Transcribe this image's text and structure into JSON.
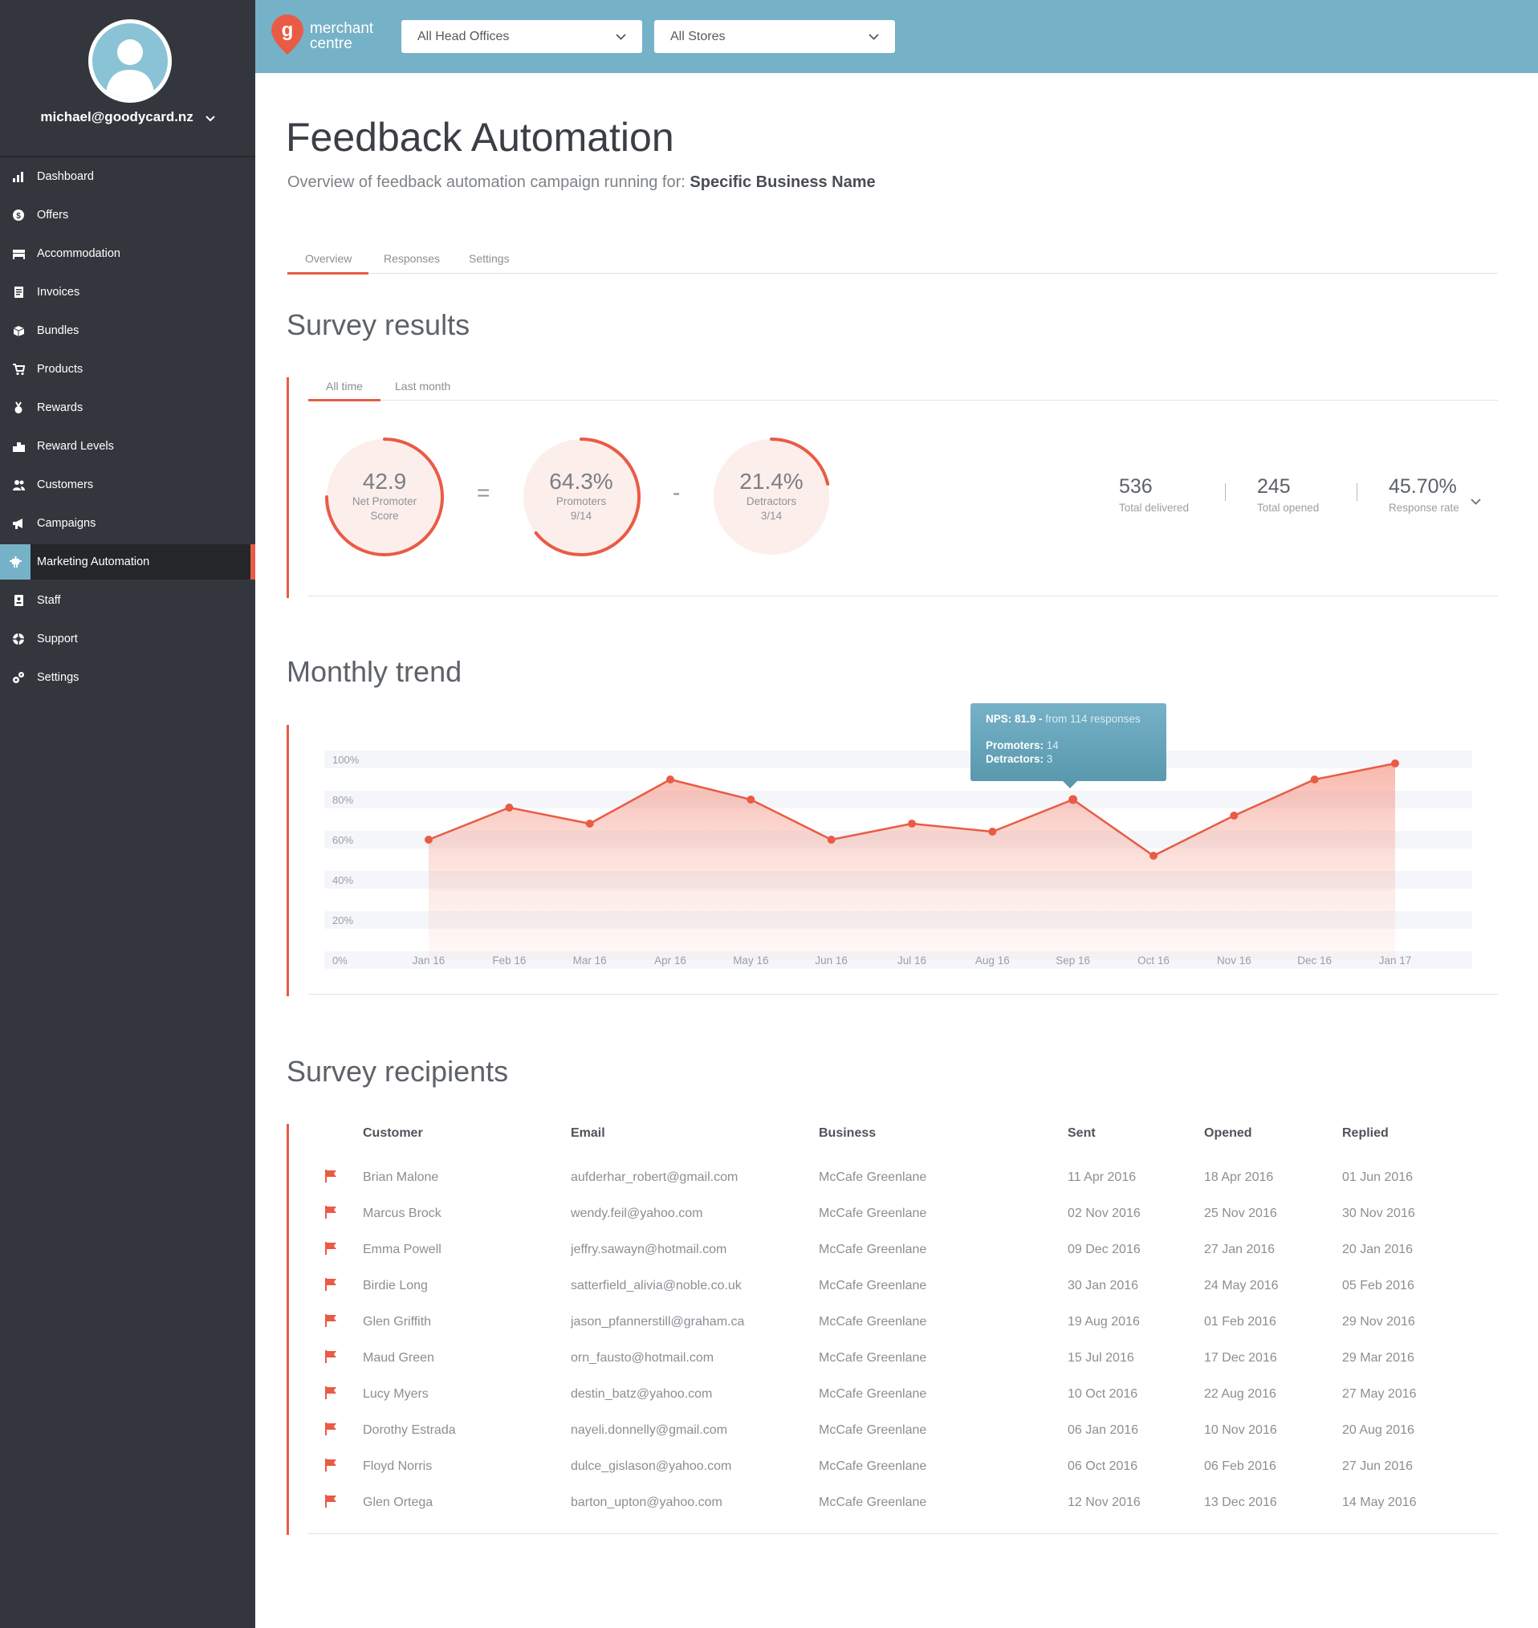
{
  "user": {
    "email": "michael@goodycard.nz"
  },
  "nav": [
    {
      "label": "Dashboard",
      "icon": "bar-chart-icon"
    },
    {
      "label": "Offers",
      "icon": "dollar-coin-icon"
    },
    {
      "label": "Accommodation",
      "icon": "bed-icon"
    },
    {
      "label": "Invoices",
      "icon": "invoice-icon"
    },
    {
      "label": "Bundles",
      "icon": "box-icon"
    },
    {
      "label": "Products",
      "icon": "cart-icon"
    },
    {
      "label": "Rewards",
      "icon": "medal-icon"
    },
    {
      "label": "Reward Levels",
      "icon": "podium-icon"
    },
    {
      "label": "Customers",
      "icon": "users-icon"
    },
    {
      "label": "Campaigns",
      "icon": "megaphone-icon"
    },
    {
      "label": "Marketing Automation",
      "icon": "robot-icon",
      "active": true
    },
    {
      "label": "Staff",
      "icon": "badge-icon"
    },
    {
      "label": "Support",
      "icon": "support-icon"
    },
    {
      "label": "Settings",
      "icon": "gears-icon"
    }
  ],
  "topbar": {
    "logo_line1": "merchant",
    "logo_line2": "centre",
    "head_office": "All Head Offices",
    "stores": "All Stores"
  },
  "colors": {
    "accent": "#e95b45",
    "brand": "#75b2c7",
    "sidebar": "#33363c"
  },
  "page": {
    "title": "Feedback Automation",
    "subtitle": "Overview of feedback automation campaign running for:",
    "business": "Specific Business Name",
    "tabs": [
      "Overview",
      "Responses",
      "Settings"
    ],
    "active_tab": "Overview"
  },
  "survey": {
    "title": "Survey results",
    "subtabs": [
      "All time",
      "Last month"
    ],
    "active_subtab": "All time",
    "nps": {
      "value": "42.9",
      "label_line1": "Net Promoter",
      "label_line2": "Score",
      "fraction": 0.75
    },
    "equals": "=",
    "promoters": {
      "value": "64.3%",
      "label": "Promoters",
      "frac": "9/14",
      "fraction": 0.643
    },
    "minus": "-",
    "detractors": {
      "value": "21.4%",
      "label": "Detractors",
      "frac": "3/14",
      "fraction": 0.214
    },
    "stats": [
      {
        "value": "536",
        "label": "Total delivered"
      },
      {
        "value": "245",
        "label": "Total opened"
      },
      {
        "value": "45.70%",
        "label": "Response rate"
      }
    ]
  },
  "trend": {
    "title": "Monthly trend",
    "tooltip": {
      "nps_label": "NPS: 81.9 -",
      "from": "from 114 responses",
      "promoters_label": "Promoters:",
      "promoters_value": "14",
      "detractors_label": "Detractors:",
      "detractors_value": "3"
    }
  },
  "chart_data": {
    "type": "area",
    "x": [
      "Jan 16",
      "Feb 16",
      "Mar 16",
      "Apr 16",
      "May 16",
      "Jun 16",
      "Jul 16",
      "Aug 16",
      "Sep 16",
      "Oct 16",
      "Nov 16",
      "Dec 16",
      "Jan 17"
    ],
    "values": [
      60,
      76,
      68,
      90,
      80,
      60,
      68,
      64,
      80,
      52,
      72,
      90,
      98
    ],
    "yticks": [
      "100%",
      "80%",
      "60%",
      "40%",
      "20%",
      "0%"
    ],
    "ylim": [
      0,
      100
    ],
    "highlight_index": 8,
    "grid": true
  },
  "recipients": {
    "title": "Survey recipients",
    "columns": [
      "Customer",
      "Email",
      "Business",
      "Sent",
      "Opened",
      "Replied"
    ],
    "rows": [
      [
        "Brian Malone",
        "aufderhar_robert@gmail.com",
        "McCafe Greenlane",
        "11 Apr 2016",
        "18 Apr 2016",
        "01 Jun 2016"
      ],
      [
        "Marcus Brock",
        "wendy.feil@yahoo.com",
        "McCafe Greenlane",
        "02 Nov 2016",
        "25 Nov 2016",
        "30 Nov 2016"
      ],
      [
        "Emma Powell",
        "jeffry.sawayn@hotmail.com",
        "McCafe Greenlane",
        "09 Dec 2016",
        "27 Jan 2016",
        "20 Jan 2016"
      ],
      [
        "Birdie Long",
        "satterfield_alivia@noble.co.uk",
        "McCafe Greenlane",
        "30 Jan 2016",
        "24 May 2016",
        "05 Feb 2016"
      ],
      [
        "Glen Griffith",
        "jason_pfannerstill@graham.ca",
        "McCafe Greenlane",
        "19 Aug 2016",
        "01 Feb 2016",
        "29 Nov 2016"
      ],
      [
        "Maud Green",
        "orn_fausto@hotmail.com",
        "McCafe Greenlane",
        "15 Jul 2016",
        "17 Dec 2016",
        "29 Mar 2016"
      ],
      [
        "Lucy Myers",
        "destin_batz@yahoo.com",
        "McCafe Greenlane",
        "10 Oct 2016",
        "22 Aug 2016",
        "27 May 2016"
      ],
      [
        "Dorothy Estrada",
        "nayeli.donnelly@gmail.com",
        "McCafe Greenlane",
        "06 Jan 2016",
        "10 Nov 2016",
        "20 Aug 2016"
      ],
      [
        "Floyd Norris",
        "dulce_gislason@yahoo.com",
        "McCafe Greenlane",
        "06 Oct 2016",
        "06 Feb 2016",
        "27 Jun 2016"
      ],
      [
        "Glen Ortega",
        "barton_upton@yahoo.com",
        "McCafe Greenlane",
        "12 Nov 2016",
        "13 Dec 2016",
        "14 May 2016"
      ]
    ]
  }
}
